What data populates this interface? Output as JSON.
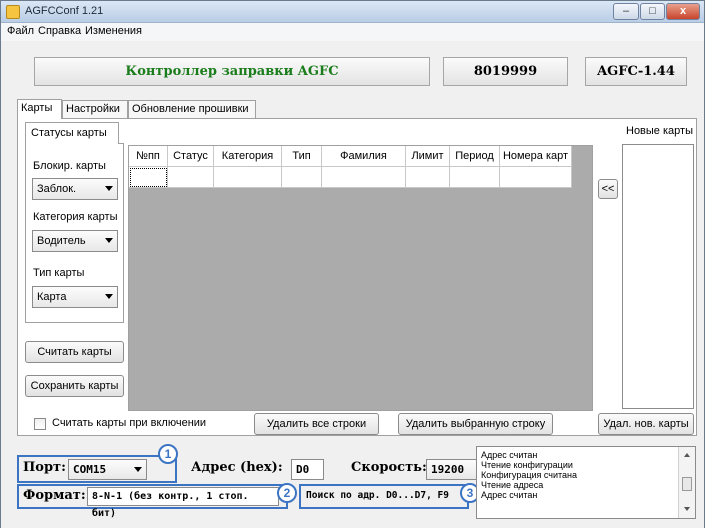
{
  "window": {
    "title": "AGFCConf 1.21",
    "minimize": "–",
    "maximize": "□",
    "close": "x"
  },
  "menu": [
    "Файл",
    "Справка",
    "Изменения"
  ],
  "header": {
    "controller": "Контроллер заправки AGFC",
    "serial": "8019999",
    "version": "AGFC-1.44"
  },
  "tabs": [
    "Карты",
    "Настройки",
    "Обновление прошивки"
  ],
  "card_status": {
    "tab": "Статусы карты",
    "block_label": "Блокир. карты",
    "block_value": "Заблок.",
    "category_label": "Категория карты",
    "category_value": "Водитель",
    "type_label": "Тип карты",
    "type_value": "Карта"
  },
  "grid": {
    "columns": [
      "№пп",
      "Статус",
      "Категория",
      "Тип",
      "Фамилия",
      "Лимит",
      "Период",
      "Номера карт"
    ]
  },
  "new_cards": {
    "label": "Новые карты",
    "move_button": "<<",
    "delete_button": "Удал. нов. карты"
  },
  "buttons": {
    "read_cards": "Считать карты",
    "save_cards": "Сохранить карты",
    "delete_all": "Удалить все строки",
    "delete_selected": "Удалить выбранную строку"
  },
  "read_on_start": "Считать карты при включении",
  "connection": {
    "port_label": "Порт:",
    "port_value": "COM15",
    "address_label": "Адрес (hex):",
    "address_value": "D0",
    "speed_label": "Скорость:",
    "speed_value": "19200",
    "format_label": "Формат:",
    "format_value": "8-N-1 (без контр., 1 стоп. бит)",
    "search": "Поиск по адр. D0...D7, F9"
  },
  "badges": [
    "1",
    "2",
    "3"
  ],
  "log": [
    "Адрес считан",
    "Чтение конфигурации",
    "Конфигурация считана",
    "Чтение адреса",
    "Адрес считан"
  ],
  "colors": {
    "accent": "#3c74c4",
    "title_green": "#1a7c1a",
    "grid_bg": "#ababab"
  }
}
